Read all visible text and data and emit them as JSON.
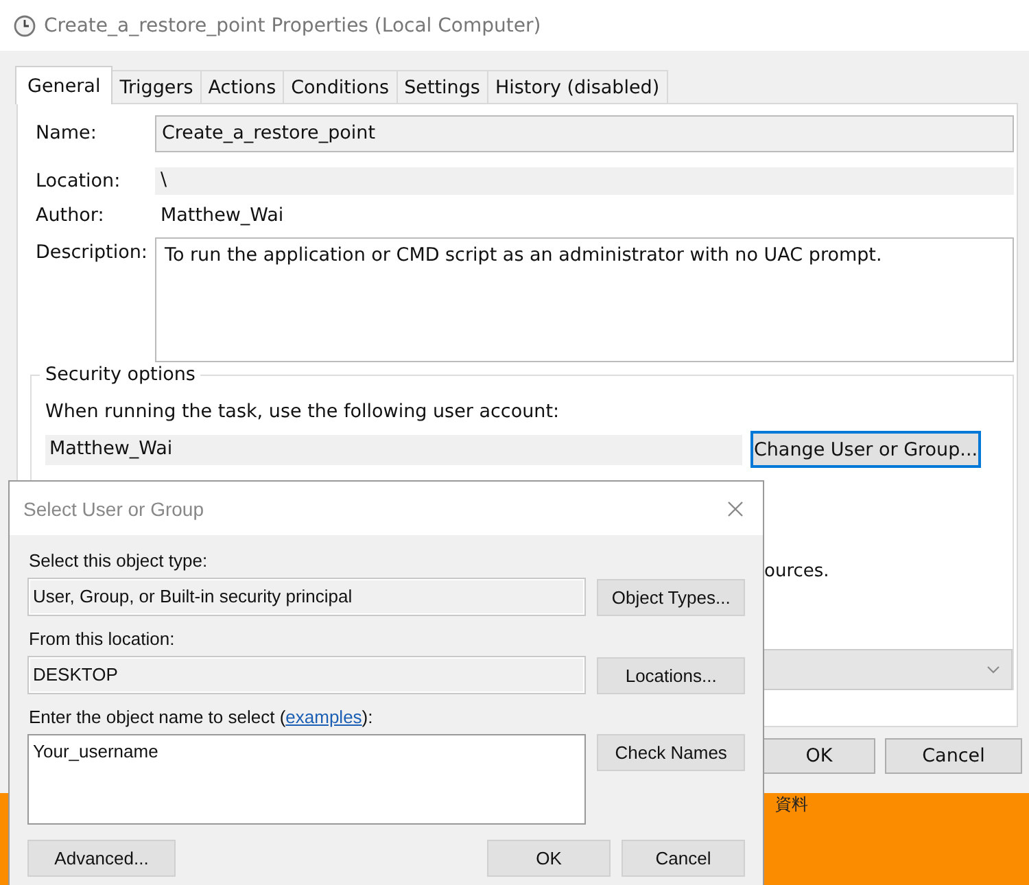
{
  "window": {
    "title": "Create_a_restore_point Properties (Local Computer)"
  },
  "tabs": [
    {
      "label": "General",
      "selected": true
    },
    {
      "label": "Triggers",
      "selected": false
    },
    {
      "label": "Actions",
      "selected": false
    },
    {
      "label": "Conditions",
      "selected": false
    },
    {
      "label": "Settings",
      "selected": false
    },
    {
      "label": "History (disabled)",
      "selected": false
    }
  ],
  "fields": [
    {
      "label": "Name:",
      "value": "Create_a_restore_point",
      "kind": "field"
    },
    {
      "label": "Location:",
      "value": "\\",
      "kind": "readonly"
    },
    {
      "label": "Author:",
      "value": "Matthew_Wai",
      "kind": "plain"
    },
    {
      "label": "Description:",
      "value": "To run the application or CMD script as an administrator with no UAC prompt.",
      "kind": "textarea"
    }
  ],
  "security": {
    "title": "Security options",
    "prompt": "When running the task, use the following user account:",
    "account": "Matthew_Wai",
    "button": "Change User or Group...",
    "fragment": "ources."
  },
  "buttons": [
    "OK",
    "Cancel"
  ],
  "background_text": "資料",
  "dialog": {
    "title": "Select User or Group",
    "type_label": "Select this object type:",
    "type_value": "User, Group, or Built-in security principal",
    "type_button": "Object Types...",
    "location_label": "From this location:",
    "location_value": "DESKTOP",
    "location_button": "Locations...",
    "name_label_before": "Enter the object name to select (",
    "name_link": "examples",
    "name_label_after": "):",
    "name_value": "Your_username",
    "check_button": "Check Names",
    "advanced_button": "Advanced...",
    "buttons": [
      "OK",
      "Cancel"
    ]
  }
}
